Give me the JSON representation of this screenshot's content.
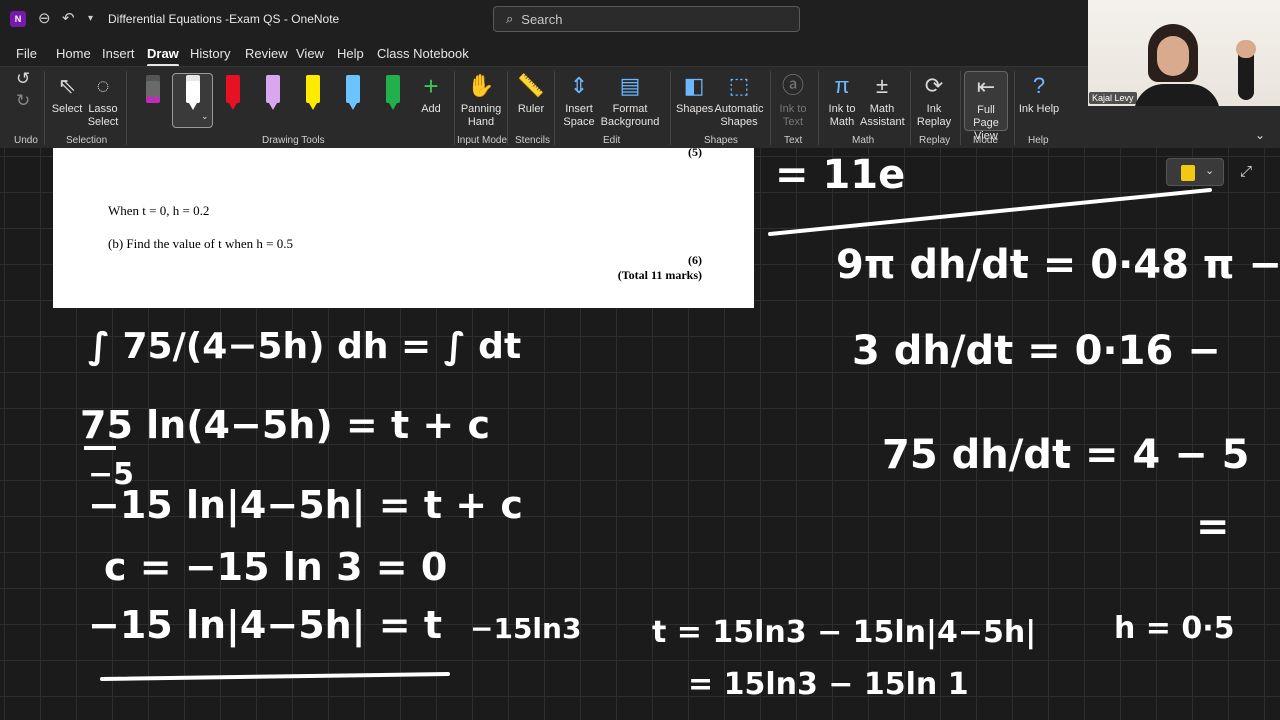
{
  "app": {
    "icon_letter": "N",
    "title": "Differential Equations -Exam QS  -  OneNote"
  },
  "search": {
    "placeholder": "Search"
  },
  "menu": [
    {
      "label": "File"
    },
    {
      "label": "Home"
    },
    {
      "label": "Insert"
    },
    {
      "label": "Draw",
      "active": true
    },
    {
      "label": "History"
    },
    {
      "label": "Review"
    },
    {
      "label": "View"
    },
    {
      "label": "Help"
    },
    {
      "label": "Class Notebook"
    }
  ],
  "ribbon": {
    "undo_group": "Undo",
    "selection": {
      "select": "Select",
      "lasso": "Lasso Select",
      "group": "Selection"
    },
    "drawing_tools": {
      "group": "Drawing Tools",
      "add": "Add",
      "pen_colors": [
        "#c22bb8",
        "#ffffff",
        "#e81123",
        "#d9a7f0",
        "#ffeb00",
        "#6cc4ff",
        "#21b04b"
      ]
    },
    "input_mode": {
      "panning": "Panning Hand",
      "group": "Input Mode"
    },
    "stencils": {
      "ruler": "Ruler",
      "group": "Stencils"
    },
    "edit": {
      "insert_space": "Insert Space",
      "format_bg": "Format Background",
      "group": "Edit"
    },
    "shapes": {
      "shapes": "Shapes",
      "auto": "Automatic Shapes",
      "group": "Shapes"
    },
    "text": {
      "ink_to_text": "Ink to Text",
      "group": "Text"
    },
    "math": {
      "ink_to_math": "Ink to Math",
      "assistant": "Math Assistant",
      "group": "Math"
    },
    "replay": {
      "ink_replay": "Ink Replay",
      "group": "Replay"
    },
    "mode": {
      "full_page": "Full Page View",
      "group": "Mode"
    },
    "help": {
      "ink_help": "Ink Help",
      "group": "Help"
    }
  },
  "exam": {
    "marks_top": "(5)",
    "condition": "When t = 0, h = 0.2",
    "question": "(b)      Find the value of t when h = 0.5",
    "marks": "(6)",
    "total": "(Total 11 marks)"
  },
  "handwriting": {
    "l1_left": "∫ 75/(4−5h) dh = ∫ dt",
    "l2": "75 ln(4−5h) = t + c",
    "l2_den": "−5",
    "l3": "−15 ln|4−5h| = t + c",
    "l4": "c = −15 ln 3  =  0",
    "l5": "−15 ln|4−5h| = t",
    "l5_right": "−15ln3",
    "r1": "= 11e",
    "r2": "9π dh/dt = 0·48 π −",
    "r3": "3 dh/dt = 0·16 −",
    "r4": "75 dh/dt =  4  − 5",
    "r5": "=",
    "b1": "t = 15ln3 − 15ln|4−5h|",
    "b2": "= 15ln3 − 15ln 1",
    "b3": "h = 0·5"
  },
  "participant": {
    "name": "Kajal Levy"
  }
}
